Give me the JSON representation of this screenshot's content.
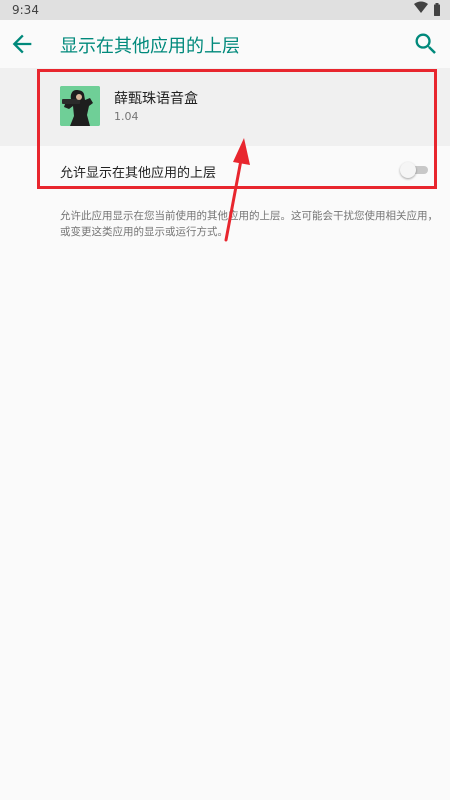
{
  "status_bar": {
    "time": "9:34",
    "icons": [
      "wifi-icon",
      "battery-icon"
    ]
  },
  "app_bar": {
    "title": "显示在其他应用的上层",
    "back_icon": "arrow-back-icon",
    "search_icon": "search-icon"
  },
  "app_info": {
    "name": "薛甄珠语音盒",
    "version": "1.04"
  },
  "setting": {
    "label": "允许显示在其他应用的上层",
    "enabled": false
  },
  "description": "允许此应用显示在您当前使用的其他应用的上层。这可能会干扰您使用相关应用，或变更这类应用的显示或运行方式。",
  "colors": {
    "accent": "#00897b",
    "annotation": "#e8262e",
    "background": "#fafafa"
  }
}
